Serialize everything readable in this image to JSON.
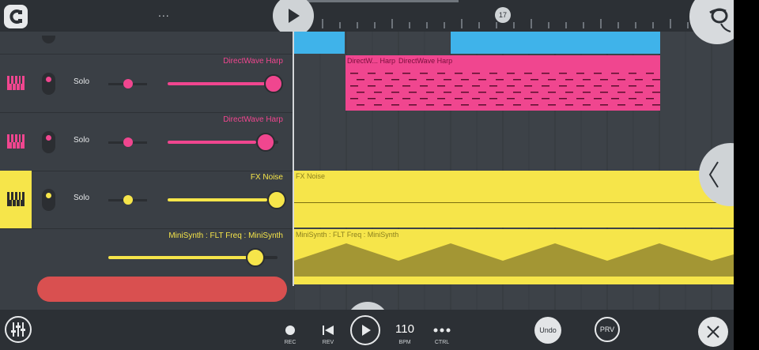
{
  "topbar": {
    "menu_dots": "...",
    "bar_marker": "17"
  },
  "tracks": [
    {
      "name": "",
      "color": "#3fb3ea",
      "selected": false
    },
    {
      "name": "DirectWave Harp",
      "color": "#f0468f",
      "solo": "Solo",
      "pan": 0.5,
      "volume": 0.96,
      "selected": false
    },
    {
      "name": "DirectWave Harp",
      "color": "#f0468f",
      "solo": "Solo",
      "pan": 0.5,
      "volume": 0.88,
      "selected": false
    },
    {
      "name": "FX Noise",
      "color": "#f6e54a",
      "solo": "Solo",
      "pan": 0.5,
      "volume": 0.98,
      "selected": true
    },
    {
      "name": "MiniSynth : FLT Freq : MiniSynth",
      "color": "#f6e54a",
      "volume": 0.86,
      "automation": true
    }
  ],
  "clips": {
    "harp_a": "DirectW... Harp",
    "harp_b": "DirectWave Harp",
    "noise": "FX Noise",
    "minisynth": "MiniSynth : FLT Freq : MiniSynth"
  },
  "transport": {
    "rec": "REC",
    "rev": "REV",
    "bpm_value": "110",
    "bpm": "BPM",
    "ctrl": "CTRL",
    "undo": "Undo",
    "prv": "PRV"
  },
  "icons": [
    "magnet-icon",
    "play-icon",
    "fruit-logo-icon",
    "piano-icon",
    "mixer-icon",
    "record-icon",
    "rewind-icon",
    "more-icon",
    "close-icon",
    "chevron-left-icon"
  ]
}
